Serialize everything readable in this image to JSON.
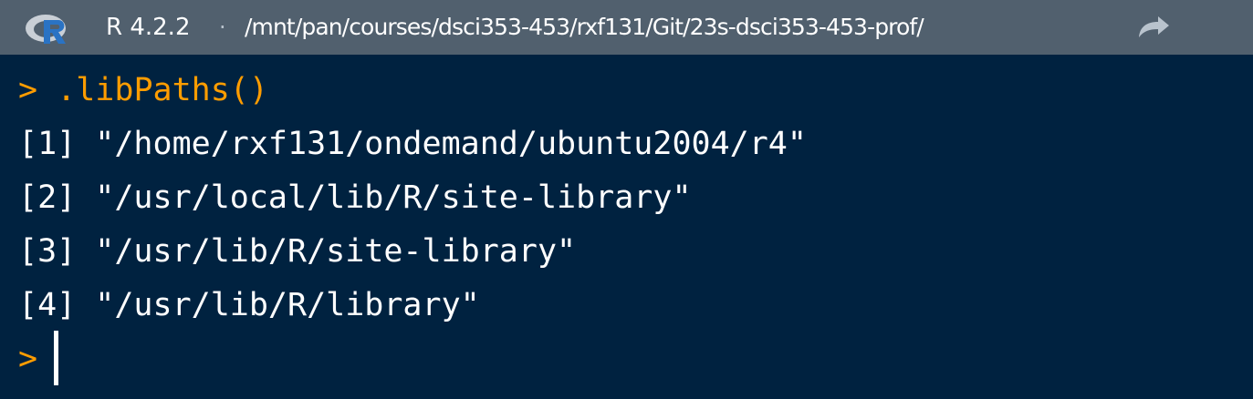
{
  "header": {
    "r_version": "R 4.2.2",
    "separator": "·",
    "working_dir": "/mnt/pan/courses/dsci353-453/rxf131/Git/23s-dsci353-453-prof/",
    "logo_icon": "r-logo-icon",
    "goto_icon": "goto-directory-icon"
  },
  "console": {
    "prompt": ">",
    "command": ".libPaths()",
    "output": [
      "[1] \"/home/rxf131/ondemand/ubuntu2004/r4\"",
      "[2] \"/usr/local/lib/R/site-library\"",
      "[3] \"/usr/lib/R/site-library\"",
      "[4] \"/usr/lib/R/library\""
    ]
  },
  "colors": {
    "background": "#002240",
    "header_background": "#51606e",
    "prompt": "#ff9d00",
    "text": "#ffffff"
  }
}
